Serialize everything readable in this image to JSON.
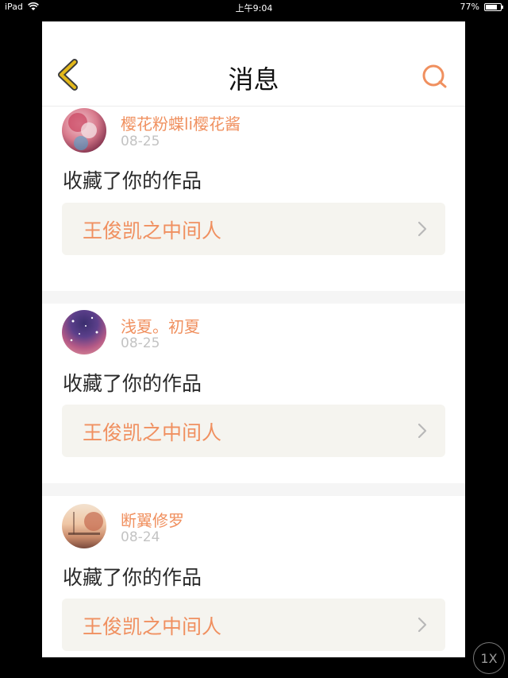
{
  "status": {
    "device": "iPad",
    "time": "上午9:04",
    "battery": "77%",
    "battery_level": 0.77
  },
  "header": {
    "title": "消息"
  },
  "messages": [
    {
      "user": "樱花粉蝶li樱花酱",
      "date": "08-25",
      "action": "收藏了你的作品",
      "work": "王俊凯之中间人"
    },
    {
      "user": "浅夏。初夏",
      "date": "08-25",
      "action": "收藏了你的作品",
      "work": "王俊凯之中间人"
    },
    {
      "user": "断翼修罗",
      "date": "08-24",
      "action": "收藏了你的作品",
      "work": "王俊凯之中间人"
    }
  ],
  "overlay": {
    "zoom_label": "1X"
  },
  "colors": {
    "accent": "#f0905f",
    "back_icon": "#e3b81a",
    "card_bg": "#f5f4ef"
  }
}
